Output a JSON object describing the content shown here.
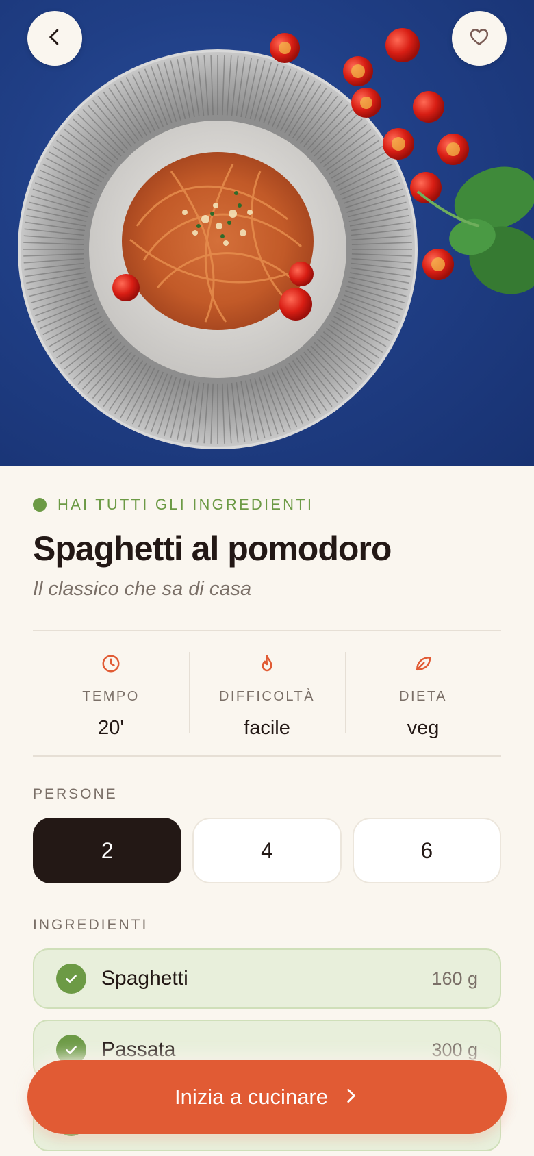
{
  "hero": {
    "back_icon": "chevron-left-icon",
    "favorite_icon": "heart-outline-icon"
  },
  "status": {
    "text": "HAI TUTTI GLI INGREDIENTI",
    "color": "#6C9A45"
  },
  "recipe": {
    "title": "Spaghetti al pomodoro",
    "subtitle": "Il classico che sa di casa"
  },
  "meta": [
    {
      "icon": "clock-icon",
      "label": "TEMPO",
      "value": "20'"
    },
    {
      "icon": "flame-icon",
      "label": "DIFFICOLTÀ",
      "value": "facile"
    },
    {
      "icon": "leaf-icon",
      "label": "DIETA",
      "value": "veg"
    }
  ],
  "servings": {
    "label": "PERSONE",
    "options": [
      "2",
      "4",
      "6"
    ],
    "selected": "2"
  },
  "ingredients": {
    "label": "INGREDIENTI",
    "items": [
      {
        "name": "Spaghetti",
        "qty": "160 g",
        "have": true
      },
      {
        "name": "Passata",
        "qty": "300 g",
        "have": true
      }
    ]
  },
  "cta": {
    "label": "Inizia a cucinare",
    "icon": "chevron-right-icon"
  },
  "colors": {
    "accent": "#E15B34",
    "success": "#6C9A45",
    "background": "#FAF6EF",
    "dark": "#231815"
  }
}
